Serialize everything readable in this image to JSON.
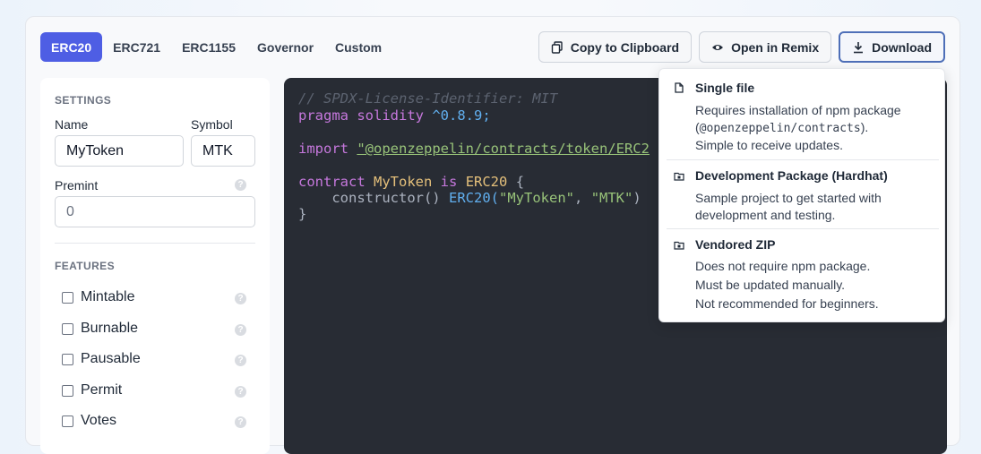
{
  "tabs": [
    "ERC20",
    "ERC721",
    "ERC1155",
    "Governor",
    "Custom"
  ],
  "actions": {
    "copy": "Copy to Clipboard",
    "remix": "Open in Remix",
    "download": "Download"
  },
  "settings": {
    "title": "SETTINGS",
    "name_label": "Name",
    "name_value": "MyToken",
    "symbol_label": "Symbol",
    "symbol_value": "MTK",
    "premint_label": "Premint",
    "premint_placeholder": "0",
    "features_title": "FEATURES",
    "features": [
      "Mintable",
      "Burnable",
      "Pausable",
      "Permit",
      "Votes"
    ],
    "help": "?"
  },
  "code": {
    "line1": "// SPDX-License-Identifier: MIT",
    "line2_kw": "pragma solidity",
    "line2_ver": "^0.8.9;",
    "line3_kw": "import",
    "line3_str": "\"@openzeppelin/contracts/token/ERC2",
    "line4_kw": "contract",
    "line4_name": "MyToken",
    "line4_is": "is",
    "line4_base": "ERC20",
    "line4_brace": "{",
    "line5_fn": "constructor()",
    "line5_call": "ERC20(",
    "line5_args_str1": "\"MyToken\"",
    "line5_comma": ",",
    "line5_args_str2": "\"MTK\"",
    "line5_close": ")",
    "line6": "}"
  },
  "download_menu": {
    "single": {
      "title": "Single file",
      "desc1": "Requires installation of npm package",
      "desc2_pre": "(",
      "desc2_mono": "@openzeppelin/contracts",
      "desc2_post": ").",
      "desc3": "Simple to receive updates."
    },
    "hardhat": {
      "title": "Development Package (Hardhat)",
      "desc1": "Sample project to get started with",
      "desc2": "development and testing."
    },
    "zip": {
      "title": "Vendored ZIP",
      "desc1": "Does not require npm package.",
      "desc2": "Must be updated manually.",
      "desc3": "Not recommended for beginners."
    }
  }
}
